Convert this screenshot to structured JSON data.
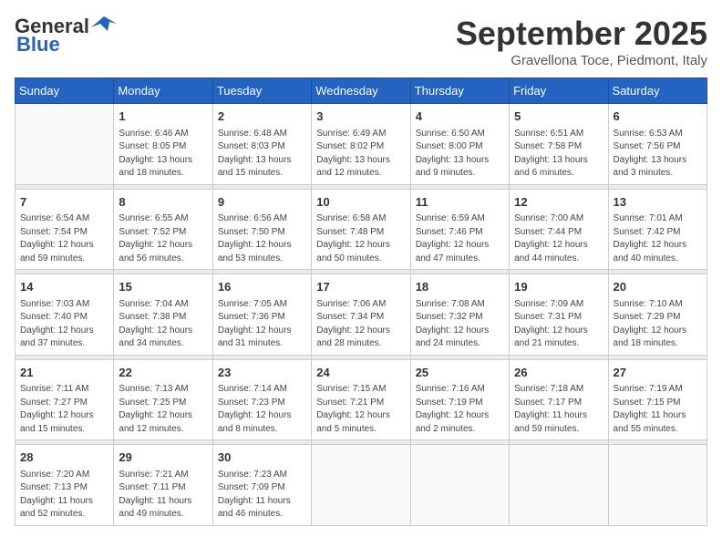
{
  "logo": {
    "line1": "General",
    "line2": "Blue"
  },
  "header": {
    "month": "September 2025",
    "location": "Gravellona Toce, Piedmont, Italy"
  },
  "weekdays": [
    "Sunday",
    "Monday",
    "Tuesday",
    "Wednesday",
    "Thursday",
    "Friday",
    "Saturday"
  ],
  "weeks": [
    [
      {
        "day": "",
        "info": ""
      },
      {
        "day": "1",
        "info": "Sunrise: 6:46 AM\nSunset: 8:05 PM\nDaylight: 13 hours\nand 18 minutes."
      },
      {
        "day": "2",
        "info": "Sunrise: 6:48 AM\nSunset: 8:03 PM\nDaylight: 13 hours\nand 15 minutes."
      },
      {
        "day": "3",
        "info": "Sunrise: 6:49 AM\nSunset: 8:02 PM\nDaylight: 13 hours\nand 12 minutes."
      },
      {
        "day": "4",
        "info": "Sunrise: 6:50 AM\nSunset: 8:00 PM\nDaylight: 13 hours\nand 9 minutes."
      },
      {
        "day": "5",
        "info": "Sunrise: 6:51 AM\nSunset: 7:58 PM\nDaylight: 13 hours\nand 6 minutes."
      },
      {
        "day": "6",
        "info": "Sunrise: 6:53 AM\nSunset: 7:56 PM\nDaylight: 13 hours\nand 3 minutes."
      }
    ],
    [
      {
        "day": "7",
        "info": "Sunrise: 6:54 AM\nSunset: 7:54 PM\nDaylight: 12 hours\nand 59 minutes."
      },
      {
        "day": "8",
        "info": "Sunrise: 6:55 AM\nSunset: 7:52 PM\nDaylight: 12 hours\nand 56 minutes."
      },
      {
        "day": "9",
        "info": "Sunrise: 6:56 AM\nSunset: 7:50 PM\nDaylight: 12 hours\nand 53 minutes."
      },
      {
        "day": "10",
        "info": "Sunrise: 6:58 AM\nSunset: 7:48 PM\nDaylight: 12 hours\nand 50 minutes."
      },
      {
        "day": "11",
        "info": "Sunrise: 6:59 AM\nSunset: 7:46 PM\nDaylight: 12 hours\nand 47 minutes."
      },
      {
        "day": "12",
        "info": "Sunrise: 7:00 AM\nSunset: 7:44 PM\nDaylight: 12 hours\nand 44 minutes."
      },
      {
        "day": "13",
        "info": "Sunrise: 7:01 AM\nSunset: 7:42 PM\nDaylight: 12 hours\nand 40 minutes."
      }
    ],
    [
      {
        "day": "14",
        "info": "Sunrise: 7:03 AM\nSunset: 7:40 PM\nDaylight: 12 hours\nand 37 minutes."
      },
      {
        "day": "15",
        "info": "Sunrise: 7:04 AM\nSunset: 7:38 PM\nDaylight: 12 hours\nand 34 minutes."
      },
      {
        "day": "16",
        "info": "Sunrise: 7:05 AM\nSunset: 7:36 PM\nDaylight: 12 hours\nand 31 minutes."
      },
      {
        "day": "17",
        "info": "Sunrise: 7:06 AM\nSunset: 7:34 PM\nDaylight: 12 hours\nand 28 minutes."
      },
      {
        "day": "18",
        "info": "Sunrise: 7:08 AM\nSunset: 7:32 PM\nDaylight: 12 hours\nand 24 minutes."
      },
      {
        "day": "19",
        "info": "Sunrise: 7:09 AM\nSunset: 7:31 PM\nDaylight: 12 hours\nand 21 minutes."
      },
      {
        "day": "20",
        "info": "Sunrise: 7:10 AM\nSunset: 7:29 PM\nDaylight: 12 hours\nand 18 minutes."
      }
    ],
    [
      {
        "day": "21",
        "info": "Sunrise: 7:11 AM\nSunset: 7:27 PM\nDaylight: 12 hours\nand 15 minutes."
      },
      {
        "day": "22",
        "info": "Sunrise: 7:13 AM\nSunset: 7:25 PM\nDaylight: 12 hours\nand 12 minutes."
      },
      {
        "day": "23",
        "info": "Sunrise: 7:14 AM\nSunset: 7:23 PM\nDaylight: 12 hours\nand 8 minutes."
      },
      {
        "day": "24",
        "info": "Sunrise: 7:15 AM\nSunset: 7:21 PM\nDaylight: 12 hours\nand 5 minutes."
      },
      {
        "day": "25",
        "info": "Sunrise: 7:16 AM\nSunset: 7:19 PM\nDaylight: 12 hours\nand 2 minutes."
      },
      {
        "day": "26",
        "info": "Sunrise: 7:18 AM\nSunset: 7:17 PM\nDaylight: 11 hours\nand 59 minutes."
      },
      {
        "day": "27",
        "info": "Sunrise: 7:19 AM\nSunset: 7:15 PM\nDaylight: 11 hours\nand 55 minutes."
      }
    ],
    [
      {
        "day": "28",
        "info": "Sunrise: 7:20 AM\nSunset: 7:13 PM\nDaylight: 11 hours\nand 52 minutes."
      },
      {
        "day": "29",
        "info": "Sunrise: 7:21 AM\nSunset: 7:11 PM\nDaylight: 11 hours\nand 49 minutes."
      },
      {
        "day": "30",
        "info": "Sunrise: 7:23 AM\nSunset: 7:09 PM\nDaylight: 11 hours\nand 46 minutes."
      },
      {
        "day": "",
        "info": ""
      },
      {
        "day": "",
        "info": ""
      },
      {
        "day": "",
        "info": ""
      },
      {
        "day": "",
        "info": ""
      }
    ]
  ]
}
